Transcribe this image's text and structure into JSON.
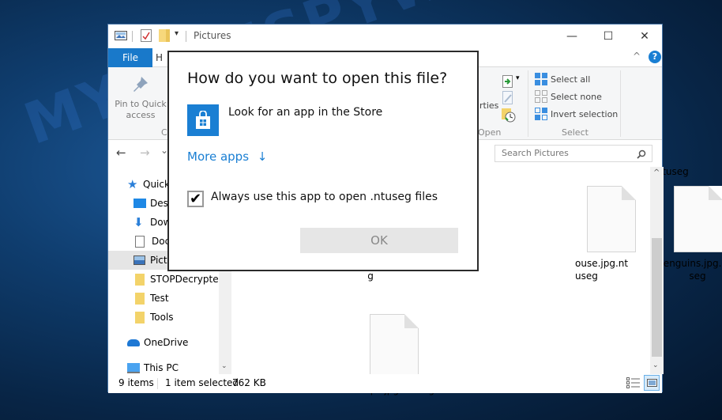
{
  "window": {
    "title": "Pictures",
    "controls": {
      "minimize": "—",
      "maximize": "☐",
      "close": "✕"
    }
  },
  "ribbon": {
    "tabs": [
      {
        "label": "File"
      },
      {
        "label": "H"
      }
    ],
    "collapse_icon": "^",
    "help_icon": "?",
    "pin": {
      "label_line1": "Pin to Quick",
      "label_line2": "access"
    },
    "clipboard_group_partial": "Cl",
    "open_group": {
      "properties_partial": "rties",
      "label": "Open"
    },
    "select_group": {
      "label": "Select",
      "items": [
        {
          "label": "Select all"
        },
        {
          "label": "Select none"
        },
        {
          "label": "Invert selection"
        }
      ]
    }
  },
  "nav": {
    "back": "←",
    "forward": "→",
    "recent": "⌄",
    "search_placeholder": "Search Pictures"
  },
  "sidebar": {
    "items": [
      {
        "label": "Quick",
        "icon": "star-icon"
      },
      {
        "label": "Desk",
        "icon": "desktop-icon"
      },
      {
        "label": "Dow",
        "icon": "download-icon"
      },
      {
        "label": "Doc",
        "icon": "document-icon"
      },
      {
        "label": "Pictu",
        "icon": "pictures-icon",
        "selected": true
      },
      {
        "label": "STOPDecrypter",
        "icon": "folder-icon"
      },
      {
        "label": "Test",
        "icon": "folder-icon"
      },
      {
        "label": "Tools",
        "icon": "folder-icon"
      },
      {
        "label": "OneDrive",
        "icon": "cloud-icon"
      },
      {
        "label": "This PC",
        "icon": "computer-icon"
      }
    ]
  },
  "files": [
    {
      "name_line1": "tuseg",
      "name_line2": ""
    },
    {
      "name_line1": "ouse.jpg.nt",
      "name_line2": "useg"
    },
    {
      "name_line1": "Penguins.jpg.ntu",
      "name_line2": "seg"
    },
    {
      "name_line1": "g",
      "name_line2": ""
    },
    {
      "name_line1": "Tulips.jpg.ntuseg",
      "name_line2": ""
    }
  ],
  "status": {
    "items_count": "9 items",
    "selected": "1 item selected",
    "size": "762 KB"
  },
  "dialog": {
    "title": "How do you want to open this file?",
    "store_option": "Look for an app in the Store",
    "more_apps": "More apps",
    "more_apps_arrow": "↓",
    "always_use_label": "Always use this app to open .ntuseg files",
    "always_use_checked": true,
    "checkmark": "✔",
    "ok_label": "OK"
  },
  "watermark": "MYANTISPYWARE.COM",
  "colors": {
    "accent": "#1a7fd3",
    "file_tab": "#1979ca"
  }
}
